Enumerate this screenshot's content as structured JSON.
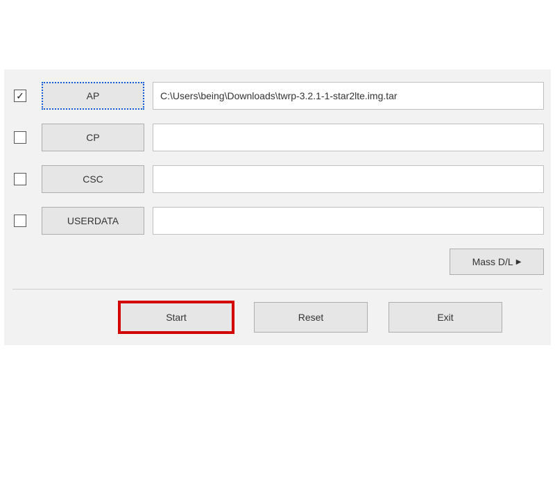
{
  "rows": [
    {
      "key": "ap",
      "label": "AP",
      "checked": true,
      "selected": true,
      "path": "C:\\Users\\being\\Downloads\\twrp-3.2.1-1-star2lte.img.tar"
    },
    {
      "key": "cp",
      "label": "CP",
      "checked": false,
      "selected": false,
      "path": ""
    },
    {
      "key": "csc",
      "label": "CSC",
      "checked": false,
      "selected": false,
      "path": ""
    },
    {
      "key": "userdata",
      "label": "USERDATA",
      "checked": false,
      "selected": false,
      "path": ""
    }
  ],
  "mass_dl_label": "Mass D/L",
  "actions": {
    "start": "Start",
    "reset": "Reset",
    "exit": "Exit"
  },
  "highlight_action": "start"
}
